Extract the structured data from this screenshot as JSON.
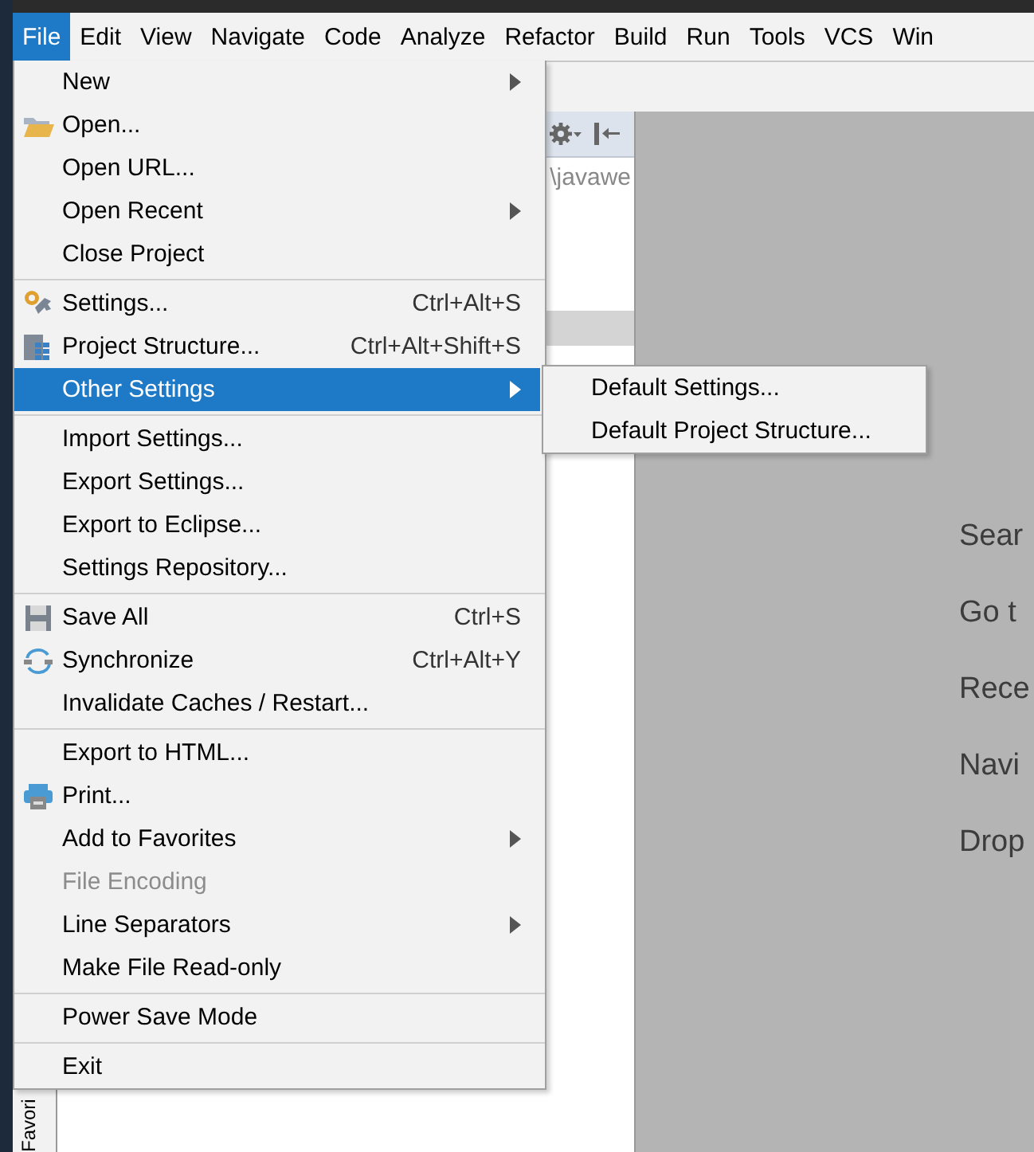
{
  "menubar": [
    {
      "label": "File",
      "selected": true
    },
    {
      "label": "Edit",
      "selected": false
    },
    {
      "label": "View",
      "selected": false
    },
    {
      "label": "Navigate",
      "selected": false
    },
    {
      "label": "Code",
      "selected": false
    },
    {
      "label": "Analyze",
      "selected": false
    },
    {
      "label": "Refactor",
      "selected": false
    },
    {
      "label": "Build",
      "selected": false
    },
    {
      "label": "Run",
      "selected": false
    },
    {
      "label": "Tools",
      "selected": false
    },
    {
      "label": "VCS",
      "selected": false
    },
    {
      "label": "Win",
      "selected": false
    }
  ],
  "project_panel": {
    "path": "\\javawe"
  },
  "side_tab": {
    "label": "Favori"
  },
  "editor_hints": [
    "Sear",
    "Go t",
    "Rece",
    "Navi",
    "Drop"
  ],
  "file_menu": [
    [
      {
        "kind": "plain",
        "label": "New",
        "submenu": true,
        "disabled": false,
        "selected": false
      },
      {
        "kind": "folder",
        "label": "Open...",
        "submenu": false,
        "disabled": false,
        "selected": false
      },
      {
        "kind": "plain",
        "label": "Open URL...",
        "submenu": false,
        "disabled": false,
        "selected": false
      },
      {
        "kind": "plain",
        "label": "Open Recent",
        "submenu": true,
        "disabled": false,
        "selected": false
      },
      {
        "kind": "plain",
        "label": "Close Project",
        "submenu": false,
        "disabled": false,
        "selected": false
      }
    ],
    [
      {
        "kind": "wrench",
        "label": "Settings...",
        "shortcut": "Ctrl+Alt+S",
        "submenu": false,
        "disabled": false,
        "selected": false
      },
      {
        "kind": "grid",
        "label": "Project Structure...",
        "shortcut": "Ctrl+Alt+Shift+S",
        "submenu": false,
        "disabled": false,
        "selected": false
      },
      {
        "kind": "plain",
        "label": "Other Settings",
        "submenu": true,
        "disabled": false,
        "selected": true,
        "children": [
          {
            "label": "Default Settings..."
          },
          {
            "label": "Default Project Structure..."
          }
        ]
      }
    ],
    [
      {
        "kind": "plain",
        "label": "Import Settings...",
        "submenu": false,
        "disabled": false,
        "selected": false
      },
      {
        "kind": "plain",
        "label": "Export Settings...",
        "submenu": false,
        "disabled": false,
        "selected": false
      },
      {
        "kind": "plain",
        "label": "Export to Eclipse...",
        "submenu": false,
        "disabled": false,
        "selected": false
      },
      {
        "kind": "plain",
        "label": "Settings Repository...",
        "submenu": false,
        "disabled": false,
        "selected": false
      }
    ],
    [
      {
        "kind": "disk",
        "label": "Save All",
        "shortcut": "Ctrl+S",
        "submenu": false,
        "disabled": false,
        "selected": false
      },
      {
        "kind": "sync",
        "label": "Synchronize",
        "shortcut": "Ctrl+Alt+Y",
        "submenu": false,
        "disabled": false,
        "selected": false
      },
      {
        "kind": "plain",
        "label": "Invalidate Caches / Restart...",
        "submenu": false,
        "disabled": false,
        "selected": false
      }
    ],
    [
      {
        "kind": "plain",
        "label": "Export to HTML...",
        "submenu": false,
        "disabled": false,
        "selected": false
      },
      {
        "kind": "printer",
        "label": "Print...",
        "submenu": false,
        "disabled": false,
        "selected": false
      },
      {
        "kind": "plain",
        "label": "Add to Favorites",
        "submenu": true,
        "disabled": false,
        "selected": false
      },
      {
        "kind": "plain",
        "label": "File Encoding",
        "submenu": false,
        "disabled": true,
        "selected": false
      },
      {
        "kind": "plain",
        "label": "Line Separators",
        "submenu": true,
        "disabled": false,
        "selected": false
      },
      {
        "kind": "plain",
        "label": "Make File Read-only",
        "submenu": false,
        "disabled": false,
        "selected": false
      }
    ],
    [
      {
        "kind": "plain",
        "label": "Power Save Mode",
        "submenu": false,
        "disabled": false,
        "selected": false
      }
    ],
    [
      {
        "kind": "plain",
        "label": "Exit",
        "submenu": false,
        "disabled": false,
        "selected": false
      }
    ]
  ]
}
